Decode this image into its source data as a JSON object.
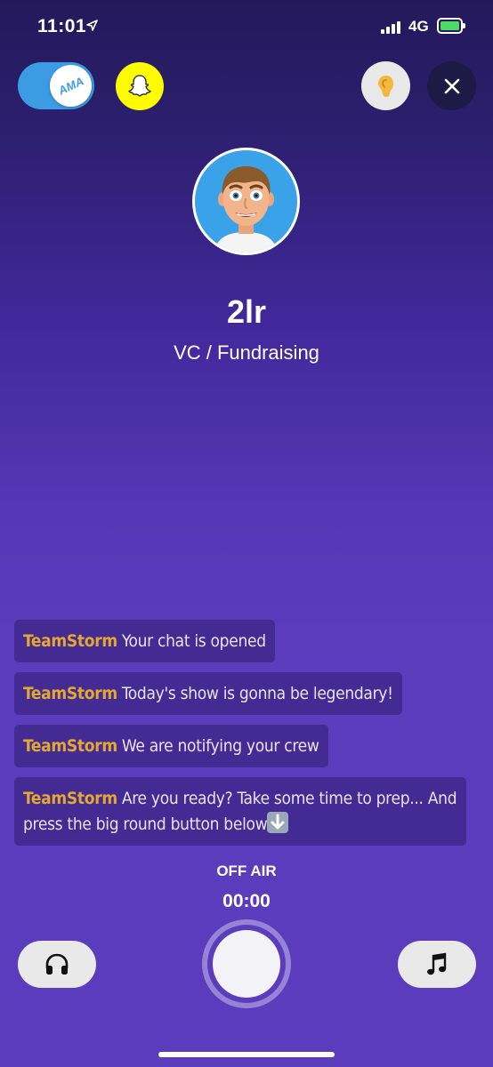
{
  "status_bar": {
    "time": "11:01",
    "network": "4G",
    "location_icon": "location-arrow-icon",
    "signal_icon": "signal-bars-icon",
    "battery_icon": "battery-charging-icon",
    "battery_color": "#4cd964"
  },
  "top_controls": {
    "ama_toggle_label": "AMA",
    "ama_toggle_on": true,
    "ama_color": "#3b9ce4",
    "snapchat_icon": "snapchat-ghost-icon",
    "snapchat_color": "#fffc00",
    "ear_icon": "ear-icon",
    "close_icon": "close-icon"
  },
  "profile": {
    "username": "2lr",
    "subtitle": "VC / Fundraising",
    "avatar_icon": "bitmoji-avatar-icon"
  },
  "chat": {
    "sender_color": "#e3a832",
    "messages": [
      {
        "sender": "TeamStorm",
        "text": "Your chat is opened"
      },
      {
        "sender": "TeamStorm",
        "text": "Today's show is gonna be legendary!"
      },
      {
        "sender": "TeamStorm",
        "text": "We are notifying your crew"
      },
      {
        "sender": "TeamStorm",
        "text": "Are you ready? Take some time to prep... And press the big round button below"
      }
    ]
  },
  "broadcast": {
    "status": "OFF AIR",
    "timer": "00:00"
  },
  "bottom_controls": {
    "headphones_icon": "headphones-icon",
    "music_icon": "music-note-icon",
    "record_icon": "record-button-icon"
  }
}
